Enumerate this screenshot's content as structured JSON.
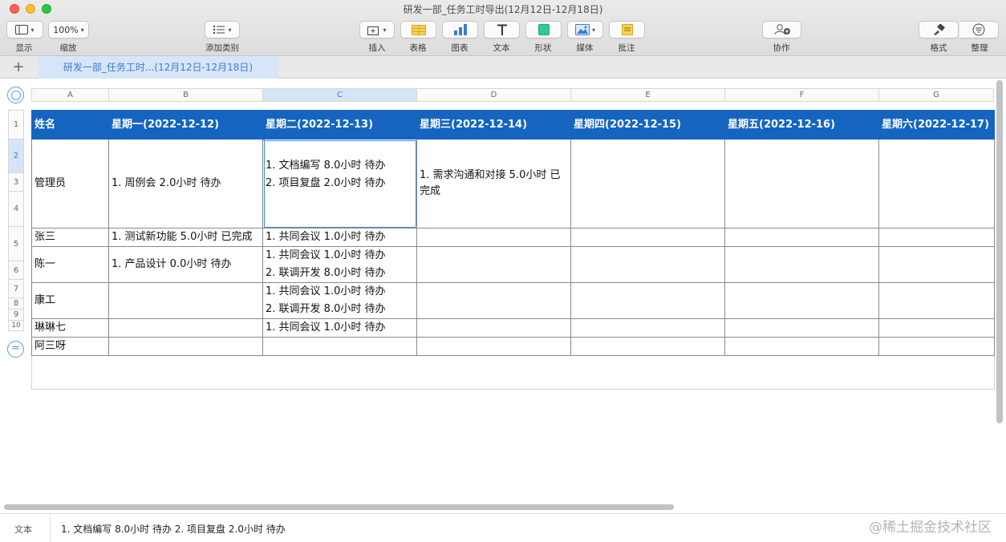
{
  "window": {
    "title": "研发一部_任务工时导出(12月12日-12月18日)"
  },
  "toolbar": {
    "view_label": "显示",
    "zoom_value": "100%",
    "zoom_label": "缩放",
    "categories_label": "添加类别",
    "insert_label": "插入",
    "table_label": "表格",
    "chart_label": "图表",
    "text_label": "文本",
    "shape_label": "形状",
    "media_label": "媒体",
    "comment_label": "批注",
    "collaborate_label": "协作",
    "format_label": "格式",
    "organize_label": "整理"
  },
  "tabs": {
    "sheet_name": "研发一部_任务工时...(12月12日-12月18日)"
  },
  "sheet": {
    "columns": [
      "A",
      "B",
      "C",
      "D",
      "E",
      "F",
      "G"
    ],
    "active_column": "C",
    "row_numbers": [
      "1",
      "2",
      "3",
      "4",
      "5",
      "6",
      "7",
      "8",
      "9",
      "10"
    ],
    "active_row": "2",
    "header": [
      "姓名",
      "星期一(2022-12-12)",
      "星期二(2022-12-13)",
      "星期三(2022-12-14)",
      "星期四(2022-12-15)",
      "星期五(2022-12-16)",
      "星期六(2022-12-17)"
    ],
    "rows": [
      [
        "管理员",
        "1. 周例会 2.0小时 待办",
        "1. 文档编写 8.0小时 待办\n2. 项目复盘 2.0小时 待办",
        "1. 需求沟通和对接 5.0小时 已完成",
        "",
        "",
        ""
      ],
      [
        "张三",
        "1. 测试新功能 5.0小时 已完成",
        "1. 共同会议 1.0小时 待办",
        "",
        "",
        "",
        ""
      ],
      [
        "陈一",
        "1. 产品设计 0.0小时 待办",
        "1. 共同会议 1.0小时 待办\n2. 联调开发 8.0小时 待办",
        "",
        "",
        "",
        ""
      ],
      [
        "康工",
        "",
        "1. 共同会议 1.0小时 待办\n2. 联调开发 8.0小时 待办",
        "",
        "",
        "",
        ""
      ],
      [
        "琳琳七",
        "",
        "1. 共同会议 1.0小时 待办",
        "",
        "",
        "",
        ""
      ],
      [
        "阿三呀",
        "",
        "",
        "",
        "",
        "",
        ""
      ]
    ],
    "header_color": "#1565c0",
    "accent_color": "#3e88e6"
  },
  "statusbar": {
    "label": "文本",
    "cell_text": "1. 文档编写 8.0小时 待办 2. 项目复盘 2.0小时 待办"
  },
  "watermark": "@稀土掘金技术社区"
}
